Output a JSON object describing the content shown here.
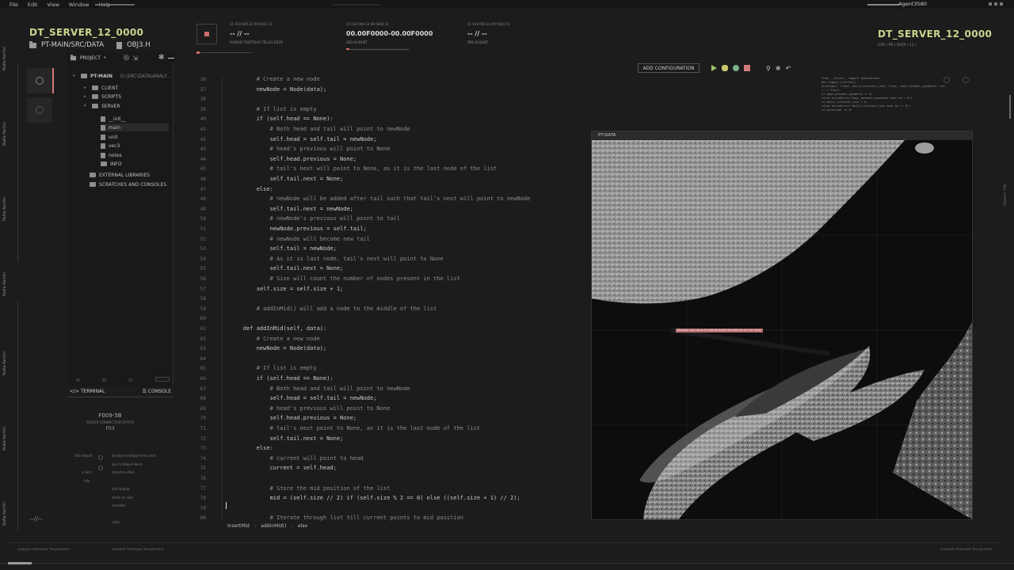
{
  "menu": [
    "File",
    "Edit",
    "View",
    "Window",
    "Help"
  ],
  "user": "Agent3580",
  "rail_labels": [
    "Nulla facilisi",
    "Nulla facilisi",
    "Nulla facilisi",
    "Nulla facilisi",
    "Nulla facilisi",
    "Nulla facilisi",
    "Nulla facilisi"
  ],
  "left_title": "DT_SERVER_12_0000",
  "right_title": "DT_SERVER_12_0000",
  "right_sub": "CVR / PR / DATA / 11 /",
  "path": "PT-MAIN/SRC/DATA",
  "file": "OBJ3.H",
  "project_label": "PROJECT",
  "tree": {
    "root": "PT-MAIN",
    "root_path": "D:\\SRC\\DATA\\ANALY...",
    "items": [
      "CLIENT",
      "SCRIPTS",
      "SERVER",
      "__init__",
      "main",
      "unit",
      "vec3",
      "notes",
      "INFO",
      "EXTERNAL LIBRARIES",
      "SCRATCHES AND CONSOLES"
    ]
  },
  "panel_footer": [
    "45",
    "85",
    "C5"
  ],
  "terminal_label": "TERMINAL",
  "console_label": "CONSOLE",
  "connection": {
    "id": "F009-5B",
    "status": "SERVER CONNECTION STATUS",
    "code": "F03"
  },
  "faint_left": [
    "Sed aliquet",
    "Quisque tristique tellus eros",
    "quis tristique libero",
    "pharetra vitae",
    "a sem",
    "vita",
    "Sed aliquet",
    "lorem ac sem",
    "convallis",
    "nullis"
  ],
  "dash_left": "--//--",
  "stats": [
    {
      "meta": "21  010  000          22-09-5403  11",
      "val": "-- // --",
      "sub": "BUSBUE TRISTIQUE TELLUS EROS"
    },
    {
      "meta": "21  010  000          22-09-5403  11",
      "val": "00.00F0000-00.00F0000",
      "sub": "SED ALIQUET"
    },
    {
      "meta": "21  010  000          22-09-5403  11",
      "val": "-- // --",
      "sub": "SED ALIQUET"
    }
  ],
  "toolbar": {
    "add_config": "ADD CONFIGURATION"
  },
  "code": {
    "lines": [
      {
        "n": "36",
        "t": "        # Create a new node",
        "c": true
      },
      {
        "n": "37",
        "t": "        newNode = Node(data);"
      },
      {
        "n": "38",
        "t": ""
      },
      {
        "n": "39",
        "t": "        # If list is empty",
        "c": true
      },
      {
        "n": "40",
        "t": "        if (self.head == None):"
      },
      {
        "n": "41",
        "t": "            # Both head and tail will point to newNode",
        "c": true
      },
      {
        "n": "42",
        "t": "            self.head = self.tail = newNode;"
      },
      {
        "n": "43",
        "t": "            # head's previous will point to None",
        "c": true
      },
      {
        "n": "44",
        "t": "            self.head.previous = None;"
      },
      {
        "n": "45",
        "t": "            # tail's next will point to None, as it is the last node of the list",
        "c": true
      },
      {
        "n": "46",
        "t": "            self.tail.next = None;"
      },
      {
        "n": "47",
        "t": "        else:"
      },
      {
        "n": "48",
        "t": "            # newNode will be added after tail such that tail's next will point to newNode",
        "c": true
      },
      {
        "n": "49",
        "t": "            self.tail.next = newNode;"
      },
      {
        "n": "50",
        "t": "            # newNode's previous will point to tail",
        "c": true
      },
      {
        "n": "51",
        "t": "            newNode.previous = self.tail;"
      },
      {
        "n": "52",
        "t": "            # newNode will become new tail",
        "c": true
      },
      {
        "n": "53",
        "t": "            self.tail = newNode;"
      },
      {
        "n": "54",
        "t": "            # As it is last node, tail's next will point to None",
        "c": true
      },
      {
        "n": "55",
        "t": "            self.tail.next = None;"
      },
      {
        "n": "56",
        "t": "            # Size will count the number of nodes present in the list",
        "c": true
      },
      {
        "n": "57",
        "t": "        self.size = self.size + 1;"
      },
      {
        "n": "58",
        "t": ""
      },
      {
        "n": "59",
        "t": "        # addInMid() will add a node to the middle of the list",
        "c": true
      },
      {
        "n": "60",
        "t": ""
      },
      {
        "n": "61",
        "t": "    def addInMid(self, data):"
      },
      {
        "n": "62",
        "t": "        # Create a new node",
        "c": true
      },
      {
        "n": "63",
        "t": "        newNode = Node(data);"
      },
      {
        "n": "64",
        "t": ""
      },
      {
        "n": "65",
        "t": "        # If list is empty",
        "c": true
      },
      {
        "n": "66",
        "t": "        if (self.head == None):"
      },
      {
        "n": "67",
        "t": "            # Both head and tail will point to newNode",
        "c": true
      },
      {
        "n": "68",
        "t": "            self.head = self.tail = newNode;"
      },
      {
        "n": "69",
        "t": "            # head's previous will point to None",
        "c": true
      },
      {
        "n": "70",
        "t": "            self.head.previous = None;"
      },
      {
        "n": "71",
        "t": "            # tail's next point to None, as it is the last node of the list",
        "c": true
      },
      {
        "n": "72",
        "t": "            self.tail.next = None;"
      },
      {
        "n": "73",
        "t": "        else:"
      },
      {
        "n": "74",
        "t": "            # current will point to head",
        "c": true
      },
      {
        "n": "75",
        "t": "            current = self.head;"
      },
      {
        "n": "76",
        "t": ""
      },
      {
        "n": "77",
        "t": "            # Store the mid position of the list",
        "c": true
      },
      {
        "n": "78",
        "t": "            mid = (self.size // 2) if (self.size % 2 == 0) else ((self.size + 1) // 2);"
      },
      {
        "n": "79",
        "t": ""
      },
      {
        "n": "80",
        "t": "            # Iterate through list till current points to mid position",
        "c": true
      }
    ]
  },
  "breadcrumb": [
    "InsertMid",
    "addInMid()",
    "else"
  ],
  "doc_snippet": [
    "from __future__ import annotations",
    "",
    "def simple_interest(",
    "    principal: float, daily_interest_rate: float, days_between_payments: int",
    ") -> float:",
    "",
    "    if days_between_payments <= 0:",
    "        raise ValueError(\"days_between_payments must be > 0\")",
    "    if daily_interest_rate < 0:",
    "        raise ValueError(\"daily_interest_rate must be >= 0\")",
    "    if principal <= 0:"
  ],
  "image_panel": {
    "title": "PT-DATA",
    "label": "Aliquam quis lacus in velit tincidunt fermentum ac nec lacus"
  },
  "footer": [
    "QUISQUE TRISTIQUE TELLUS EROS",
    "QUISQUE TRISTIQUE TELLUS EROS",
    "QUISQUE TRISTIQUE TELLUS EROS"
  ],
  "search_label": "Search info"
}
